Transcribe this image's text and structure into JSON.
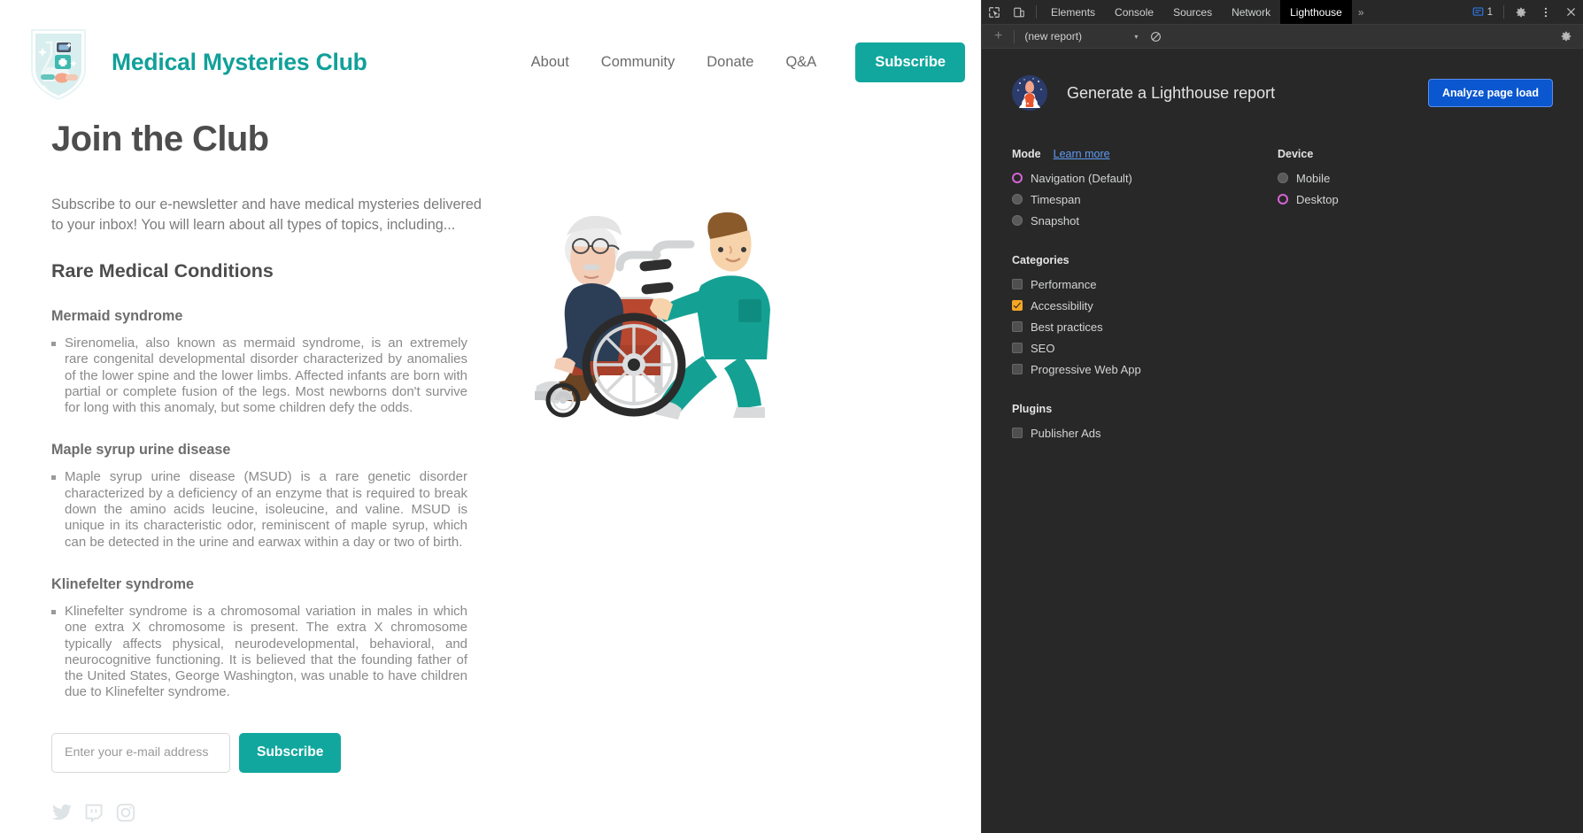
{
  "site": {
    "title": "Medical Mysteries Club",
    "logo_icon": "medical-shield-badge-icon",
    "brand_color": "#11a09a",
    "nav": [
      {
        "label": "About"
      },
      {
        "label": "Community"
      },
      {
        "label": "Donate"
      },
      {
        "label": "Q&A"
      }
    ],
    "nav_cta": "Subscribe"
  },
  "main": {
    "page_title": "Join the Club",
    "intro": "Subscribe to our e-newsletter and have medical mysteries delivered to your inbox! You will learn about all types of topics, including...",
    "section_title": "Rare Medical Conditions",
    "conditions": [
      {
        "name": "Mermaid syndrome",
        "description": "Sirenomelia, also known as mermaid syndrome, is an extremely rare congenital developmental disorder characterized by anomalies of the lower spine and the lower limbs. Affected infants are born with partial or complete fusion of the legs. Most newborns don't survive for long with this anomaly, but some children defy the odds."
      },
      {
        "name": "Maple syrup urine disease",
        "description": "Maple syrup urine disease (MSUD) is a rare genetic disorder characterized by a deficiency of an enzyme that is required to break down the amino acids leucine, isoleucine, and valine. MSUD is unique in its characteristic odor, reminiscent of maple syrup, which can be detected in the urine and earwax within a day or two of birth."
      },
      {
        "name": "Klinefelter syndrome",
        "description": "Klinefelter syndrome is a chromosomal variation in males in which one extra X chromosome is present. The extra X chromosome typically affects physical, neurodevelopmental, behavioral, and neurocognitive functioning. It is believed that the founding father of the United States, George Washington, was unable to have children due to Klinefelter syndrome."
      }
    ],
    "illustration": "nurse-pushing-elderly-man-in-wheelchair-illustration",
    "form": {
      "email_placeholder": "Enter your e-mail address",
      "email_value": "",
      "submit_label": "Subscribe"
    },
    "social": [
      {
        "name": "twitter-icon"
      },
      {
        "name": "twitch-icon"
      },
      {
        "name": "instagram-icon"
      }
    ]
  },
  "devtools": {
    "tabs": [
      {
        "label": "Elements",
        "active": false
      },
      {
        "label": "Console",
        "active": false
      },
      {
        "label": "Sources",
        "active": false
      },
      {
        "label": "Network",
        "active": false
      },
      {
        "label": "Lighthouse",
        "active": true
      }
    ],
    "more_tabs_label": "»",
    "issues_count": "1",
    "toolbar": {
      "add_label": "+",
      "report_select_value": "(new report)",
      "caret": "▾",
      "clear_icon": "clear-icon",
      "settings_icon": "gear-icon"
    },
    "lighthouse": {
      "heading": "Generate a Lighthouse report",
      "logo_icon": "lighthouse-lantern-icon",
      "analyze_label": "Analyze page load",
      "mode": {
        "title": "Mode",
        "learn_more": "Learn more",
        "options": [
          {
            "label": "Navigation (Default)",
            "selected": true
          },
          {
            "label": "Timespan",
            "selected": false
          },
          {
            "label": "Snapshot",
            "selected": false
          }
        ]
      },
      "device": {
        "title": "Device",
        "options": [
          {
            "label": "Mobile",
            "selected": false
          },
          {
            "label": "Desktop",
            "selected": true
          }
        ]
      },
      "categories": {
        "title": "Categories",
        "options": [
          {
            "label": "Performance",
            "checked": false
          },
          {
            "label": "Accessibility",
            "checked": true
          },
          {
            "label": "Best practices",
            "checked": false
          },
          {
            "label": "SEO",
            "checked": false
          },
          {
            "label": "Progressive Web App",
            "checked": false
          }
        ]
      },
      "plugins": {
        "title": "Plugins",
        "options": [
          {
            "label": "Publisher Ads",
            "checked": false
          }
        ]
      }
    }
  }
}
